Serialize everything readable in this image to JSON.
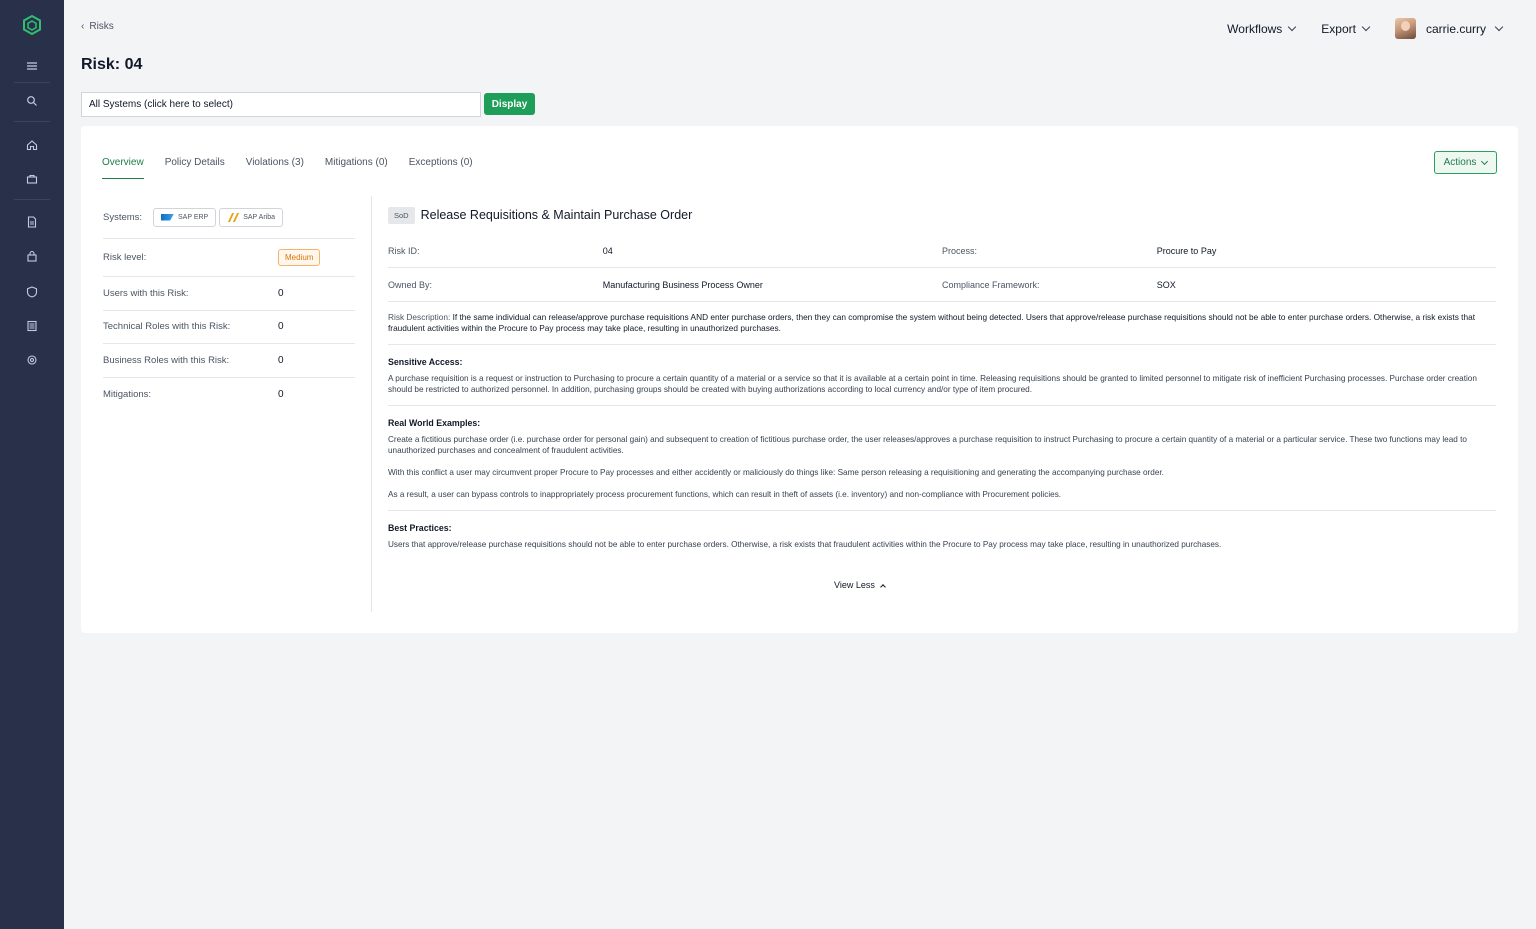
{
  "sidebar": {
    "icons": [
      "logo-icon",
      "menu-icon",
      "search-icon",
      "home-icon",
      "briefcase-icon",
      "document-icon",
      "lock-icon",
      "shield-icon",
      "report-icon",
      "settings-icon"
    ]
  },
  "breadcrumb": {
    "label": "Risks"
  },
  "page": {
    "title": "Risk: 04"
  },
  "header": {
    "workflows_label": "Workflows",
    "export_label": "Export",
    "username": "carrie.curry"
  },
  "system_select": {
    "value": "All Systems (click here to select)",
    "display_label": "Display"
  },
  "tabs": [
    {
      "label": "Overview"
    },
    {
      "label": "Policy Details"
    },
    {
      "label": "Violations (3)"
    },
    {
      "label": "Mitigations (0)"
    },
    {
      "label": "Exceptions (0)"
    }
  ],
  "actions_label": "Actions",
  "summary": {
    "systems_label": "Systems:",
    "systems": [
      "SAP ERP",
      "SAP Ariba"
    ],
    "risk_level_label": "Risk level:",
    "risk_level": "Medium",
    "users_label": "Users with this Risk:",
    "users": "0",
    "tech_roles_label": "Technical Roles with this Risk:",
    "tech_roles": "0",
    "business_roles_label": "Business Roles with this Risk:",
    "business_roles": "0",
    "mitigations_label": "Mitigations:",
    "mitigations": "0"
  },
  "detail": {
    "type_chip": "SoD",
    "title": "Release Requisitions & Maintain Purchase Order",
    "risk_id_label": "Risk ID:",
    "risk_id": "04",
    "process_label": "Process:",
    "process": "Procure to Pay",
    "owned_by_label": "Owned By:",
    "owned_by": "Manufacturing Business Process Owner",
    "framework_label": "Compliance Framework:",
    "framework": "SOX",
    "description_label": "Risk Description:",
    "description": "If the same individual can release/approve purchase requisitions AND enter purchase orders, then they can compromise the system without being detected. Users that approve/release purchase requisitions should not be able to enter purchase orders. Otherwise, a risk exists that fraudulent activities within the Procure to Pay process may take place, resulting in unauthorized purchases.",
    "sensitive_access_heading": "Sensitive Access:",
    "sensitive_access": "A purchase requisition is a request or instruction to Purchasing to procure a certain quantity of a material or a service so that it is available at a certain point in time. Releasing requisitions should be granted to limited personnel to mitigate risk of inefficient Purchasing processes. Purchase order creation should be restricted to authorized personnel. In addition, purchasing groups should be created with buying authorizations according to local currency and/or type of item procured.",
    "real_world_heading": "Real World Examples:",
    "real_world_1": "Create a fictitious purchase order (i.e. purchase order for personal gain) and subsequent to creation of fictitious purchase order, the user releases/approves a purchase requisition to instruct Purchasing to procure a certain quantity of a material or a particular service. These two functions may lead to unauthorized purchases and concealment of fraudulent activities.",
    "real_world_2": "With this conflict a user may circumvent proper Procure to Pay processes and either accidently or maliciously do things like: Same person releasing a requisitioning and generating the accompanying purchase order.",
    "real_world_3": "As a result, a user can bypass controls to inappropriately process procurement functions, which can result in theft of assets (i.e. inventory) and non-compliance with Procurement policies.",
    "best_practices_heading": "Best Practices:",
    "best_practices": "Users that approve/release purchase requisitions should not be able to enter purchase orders. Otherwise, a risk exists that fraudulent activities within the Procure to Pay process may take place, resulting in unauthorized purchases.",
    "view_less_label": "View Less"
  }
}
